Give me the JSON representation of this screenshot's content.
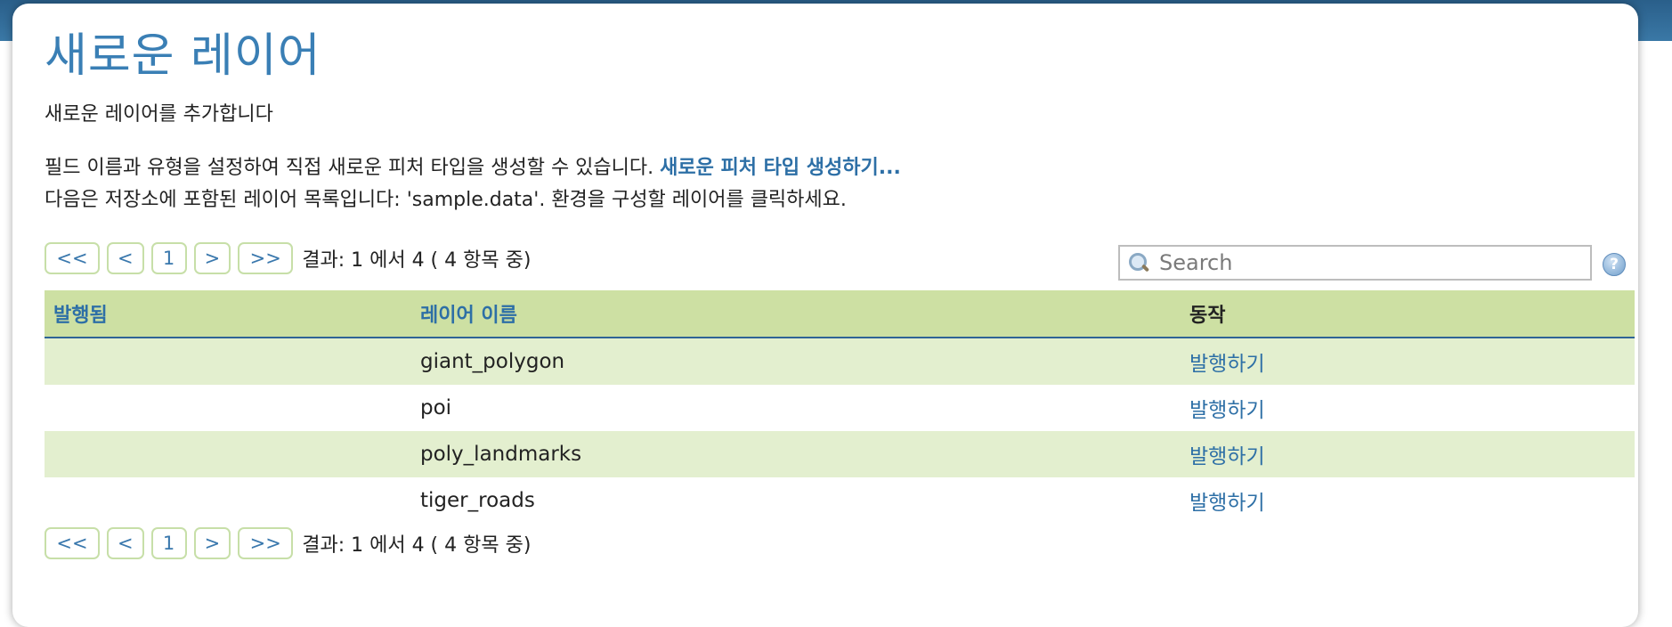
{
  "page": {
    "title": "새로운 레이어",
    "subtitle": "새로운 레이어를 추가합니다",
    "desc1_text": "필드 이름과 유형을 설정하여 직접 새로운 피처 타입을 생성할 수 있습니다. ",
    "desc1_link": "새로운 피처 타입 생성하기...",
    "desc2": "다음은 저장소에 포함된 레이어 목록입니다: 'sample.data'. 환경을 구성할 레이어를 클릭하세요."
  },
  "pager": {
    "first": "<<",
    "prev": "<",
    "page": "1",
    "next": ">",
    "last": ">>",
    "info": "결과: 1 에서 4 ( 4 항목 중)"
  },
  "search": {
    "placeholder": "Search",
    "icon": "search-icon",
    "help_icon": "help-icon"
  },
  "table": {
    "headers": [
      "발행됨",
      "레이어 이름",
      "동작"
    ],
    "rows": [
      {
        "published": "",
        "name": "giant_polygon",
        "action": "발행하기"
      },
      {
        "published": "",
        "name": "poi",
        "action": "발행하기"
      },
      {
        "published": "",
        "name": "poly_landmarks",
        "action": "발행하기"
      },
      {
        "published": "",
        "name": "tiger_roads",
        "action": "발행하기"
      }
    ]
  },
  "colors": {
    "title": "#3a7fb5",
    "link": "#2d6fa6",
    "header_bg": "#cde0a3",
    "row_alt_bg": "#e3efcf"
  }
}
